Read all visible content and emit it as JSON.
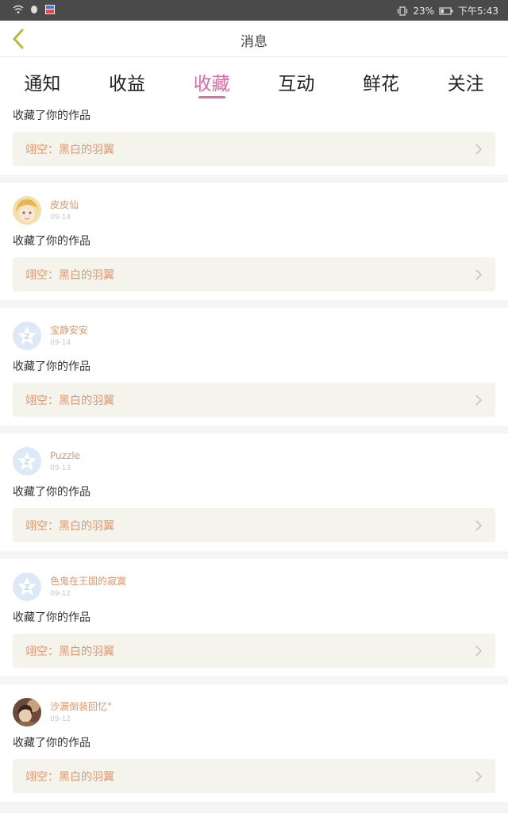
{
  "status_bar": {
    "right_text": "23%",
    "time": "下午5:43"
  },
  "header": {
    "title": "消息"
  },
  "tabs": [
    {
      "label": "通知"
    },
    {
      "label": "收益"
    },
    {
      "label": "收藏"
    },
    {
      "label": "互动"
    },
    {
      "label": "鲜花"
    },
    {
      "label": "关注"
    }
  ],
  "active_tab": "收藏",
  "items": [
    {
      "user": "",
      "time": "",
      "action": "收藏了你的作品",
      "work": "翊空：黑白的羽翼"
    },
    {
      "user": "皮皮仙",
      "time": "09-14",
      "action": "收藏了你的作品",
      "work": "翊空：黑白的羽翼"
    },
    {
      "user": "宝静安安",
      "time": "09-14",
      "action": "收藏了你的作品",
      "work": "翊空：黑白的羽翼"
    },
    {
      "user": "Puzzle",
      "time": "09-13",
      "action": "收藏了你的作品",
      "work": "翊空：黑白的羽翼"
    },
    {
      "user": "色鬼在王国的寂寞",
      "time": "09-12",
      "action": "收藏了你的作品",
      "work": "翊空：黑白的羽翼"
    },
    {
      "user": "沙漏倒装回忆°",
      "time": "09-12",
      "action": "收藏了你的作品",
      "work": "翊空：黑白的羽翼"
    }
  ],
  "colors": {
    "accent": "#e06aa6",
    "username": "#e2966b",
    "work_bg": "#f4f4ec",
    "back_arrow": "#c7b53a"
  },
  "icons": {
    "back": "chevron-left-icon",
    "row_arrow": "chevron-right-icon",
    "default_avatar": "star-avatar-icon"
  }
}
